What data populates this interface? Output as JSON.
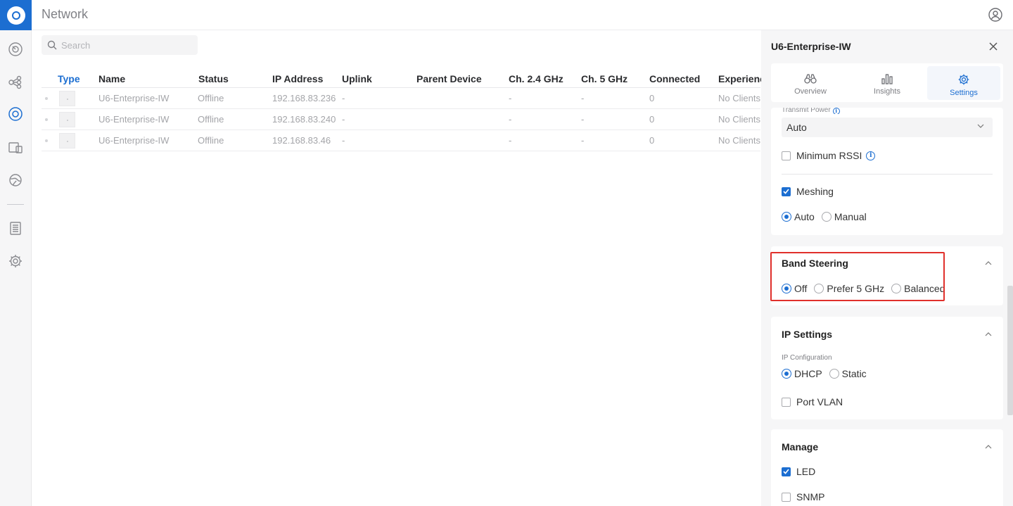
{
  "header": {
    "title": "Network"
  },
  "search": {
    "placeholder": "Search"
  },
  "table": {
    "columns": [
      "Type",
      "Name",
      "Status",
      "IP Address",
      "Uplink",
      "Parent Device",
      "Ch. 2.4 GHz",
      "Ch. 5 GHz",
      "Connected",
      "Experienc"
    ],
    "rows": [
      {
        "name": "U6-Enterprise-IW",
        "status": "Offline",
        "ip": "192.168.83.236",
        "uplink": "-",
        "ch24": "-",
        "ch5": "-",
        "connected": "0",
        "experience": "No Clients"
      },
      {
        "name": "U6-Enterprise-IW",
        "status": "Offline",
        "ip": "192.168.83.240",
        "uplink": "-",
        "ch24": "-",
        "ch5": "-",
        "connected": "0",
        "experience": "No Clients"
      },
      {
        "name": "U6-Enterprise-IW",
        "status": "Offline",
        "ip": "192.168.83.46",
        "uplink": "-",
        "ch24": "-",
        "ch5": "-",
        "connected": "0",
        "experience": "No Clients"
      }
    ]
  },
  "panel": {
    "title": "U6-Enterprise-IW",
    "tabs": [
      {
        "label": "Overview",
        "icon": "binoculars-icon"
      },
      {
        "label": "Insights",
        "icon": "bar-chart-icon"
      },
      {
        "label": "Settings",
        "icon": "gear-icon"
      }
    ],
    "radio": {
      "transmit_power_label": "Transmit Power",
      "transmit_power_value": "Auto",
      "min_rssi_label": "Minimum RSSI",
      "meshing_label": "Meshing",
      "meshing_options": [
        "Auto",
        "Manual"
      ]
    },
    "band_steering": {
      "title": "Band Steering",
      "options": [
        "Off",
        "Prefer 5 GHz",
        "Balanced"
      ]
    },
    "ip_settings": {
      "title": "IP Settings",
      "config_label": "IP Configuration",
      "options": [
        "DHCP",
        "Static"
      ],
      "port_vlan_label": "Port VLAN"
    },
    "manage": {
      "title": "Manage",
      "led_label": "LED",
      "snmp_label": "SNMP"
    }
  },
  "colors": {
    "accent": "#1c6ed1",
    "highlight": "#e0302b"
  }
}
